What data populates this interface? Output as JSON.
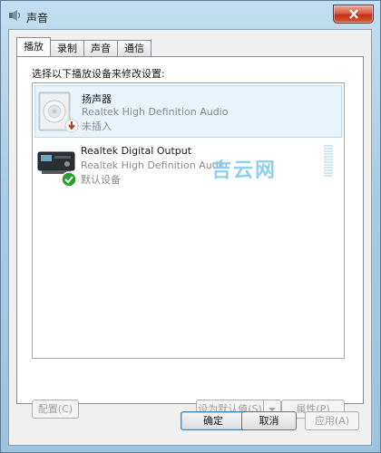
{
  "window": {
    "title": "声音",
    "close_icon": "close-icon"
  },
  "tabs": [
    {
      "label": "播放",
      "active": true
    },
    {
      "label": "录制",
      "active": false
    },
    {
      "label": "声音",
      "active": false
    },
    {
      "label": "通信",
      "active": false
    }
  ],
  "instruction": "选择以下播放设备来修改设置:",
  "devices": [
    {
      "name": "扬声器",
      "description": "Realtek High Definition Audio",
      "status": "未插入",
      "icon": "speaker-icon",
      "badge": "unplugged-icon"
    },
    {
      "name": "Realtek Digital Output",
      "description": "Realtek High Definition Audio",
      "status": "默认设备",
      "icon": "digital-output-icon",
      "badge": "default-check-icon"
    }
  ],
  "watermark": "吉云网",
  "buttons": {
    "configure": "配置(C)",
    "set_default": "设为默认值(S)",
    "properties": "属性(P)",
    "ok": "确定",
    "cancel": "取消",
    "apply": "应用(A)"
  },
  "colors": {
    "selection": "#e8f3fb",
    "close_button": "#c9452a",
    "default_check": "#27a12c",
    "unplugged_badge": "#c0392b"
  }
}
